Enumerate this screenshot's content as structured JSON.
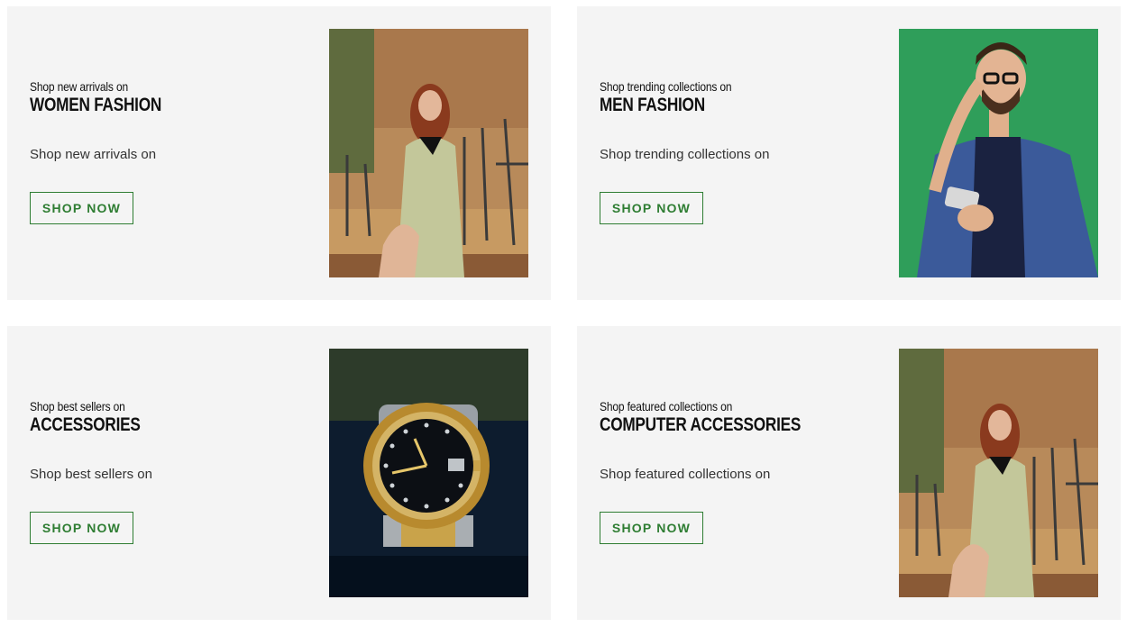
{
  "cards": [
    {
      "eyebrow": "Shop new arrivals on",
      "title": "WOMEN FASHION",
      "description": "Shop new arrivals on",
      "button": "SHOP NOW",
      "image_icon": "woman-photo"
    },
    {
      "eyebrow": "Shop trending collections on",
      "title": "MEN FASHION",
      "description": "Shop trending collections on",
      "button": "SHOP NOW",
      "image_icon": "man-photo"
    },
    {
      "eyebrow": "Shop best sellers on",
      "title": "ACCESSORIES",
      "description": "Shop best sellers on",
      "button": "SHOP NOW",
      "image_icon": "watch-photo"
    },
    {
      "eyebrow": "Shop featured collections on",
      "title": "COMPUTER ACCESSORIES",
      "description": "Shop featured collections on",
      "button": "SHOP NOW",
      "image_icon": "woman-photo"
    }
  ],
  "colors": {
    "accent": "#2e7d32",
    "card_bg": "#f4f4f4",
    "man_bg": "#2f9e5a"
  }
}
